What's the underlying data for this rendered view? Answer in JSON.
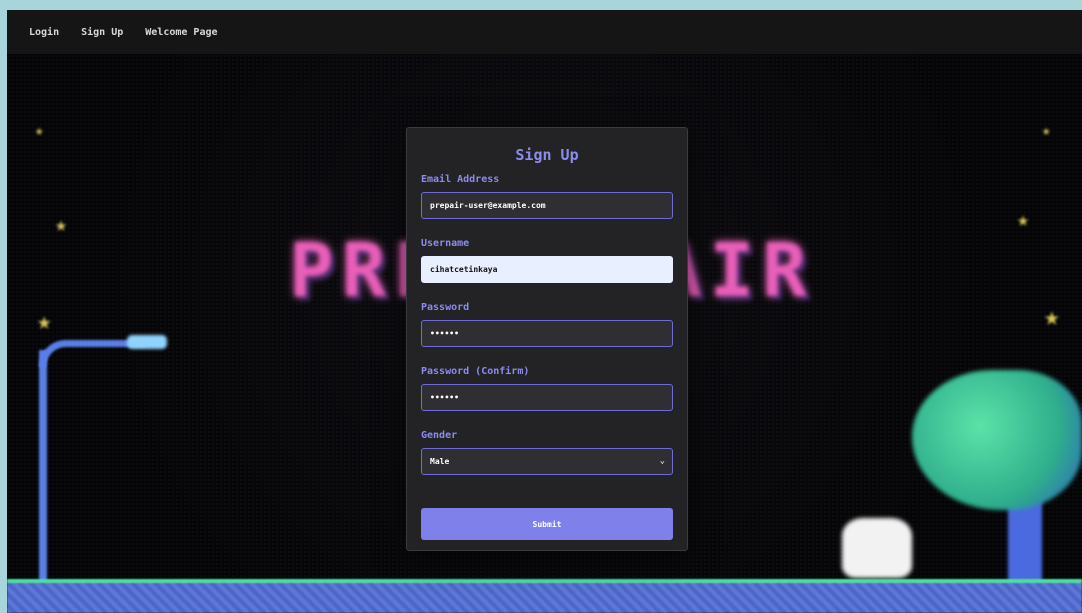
{
  "nav": {
    "login": "Login",
    "signup": "Sign Up",
    "welcome": "Welcome Page"
  },
  "background": {
    "logo_text": "PRE - PAIR",
    "colors": {
      "logo": "#e85fb8",
      "ground": "#5f78d8",
      "grass": "#4de0a0",
      "tree": "#5be3a8",
      "star": "#d9c75a"
    }
  },
  "form": {
    "title": "Sign Up",
    "email": {
      "label": "Email Address",
      "value": "prepair-user@example.com"
    },
    "username": {
      "label": "Username",
      "value": "cihatcetinkaya"
    },
    "password": {
      "label": "Password",
      "value": "••••••"
    },
    "password_confirm": {
      "label": "Password (Confirm)",
      "value": "••••••"
    },
    "gender": {
      "label": "Gender",
      "selected": "Male"
    },
    "submit_label": "Submit",
    "accent_color": "#7f80ea"
  }
}
